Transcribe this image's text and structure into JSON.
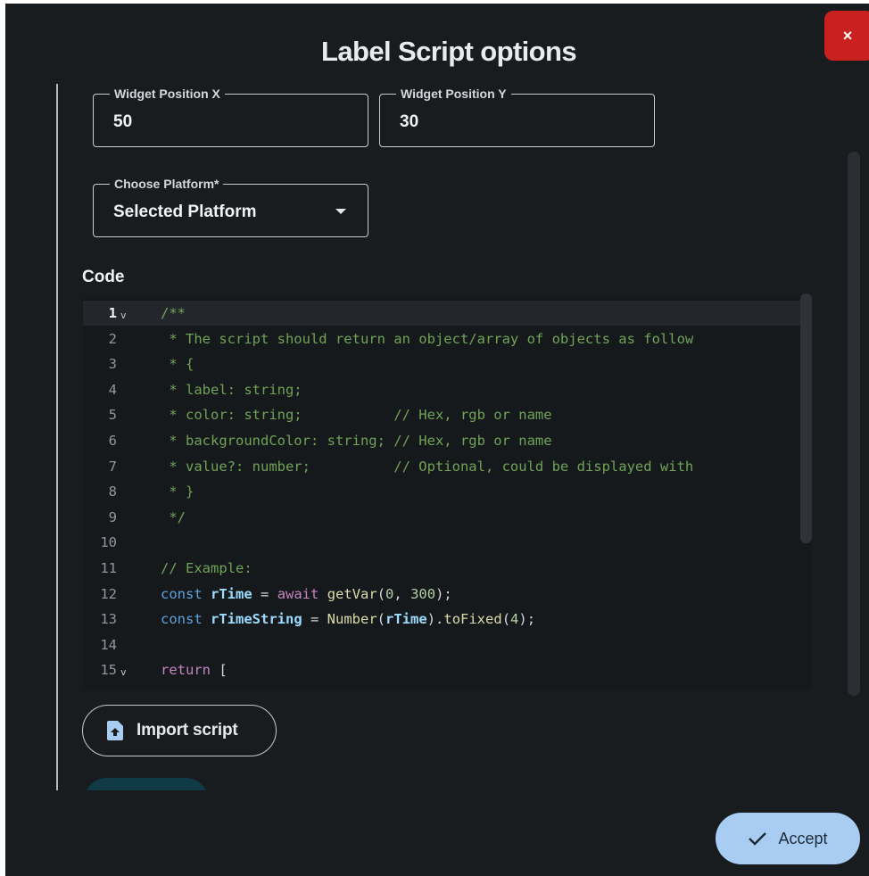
{
  "dialog": {
    "title": "Label Script options",
    "close_label": "×"
  },
  "fields": {
    "position_x": {
      "legend": "Widget Position X",
      "value": "50"
    },
    "position_y": {
      "legend": "Widget Position Y",
      "value": "30"
    },
    "platform": {
      "legend": "Choose Platform*",
      "value": "Selected Platform"
    }
  },
  "code": {
    "label": "Code",
    "lines": [
      {
        "n": "1",
        "fold": true,
        "active": true,
        "text": "/**"
      },
      {
        "n": "2",
        "text": " * The script should return an object/array of objects as follow"
      },
      {
        "n": "3",
        "text": " * {"
      },
      {
        "n": "4",
        "text": " * label: string;"
      },
      {
        "n": "5",
        "text": " * color: string;           // Hex, rgb or name"
      },
      {
        "n": "6",
        "text": " * backgroundColor: string; // Hex, rgb or name"
      },
      {
        "n": "7",
        "text": " * value?: number;          // Optional, could be displayed with"
      },
      {
        "n": "8",
        "text": " * }"
      },
      {
        "n": "9",
        "text": " */"
      },
      {
        "n": "10",
        "text": ""
      },
      {
        "n": "11",
        "text": "// Example:"
      },
      {
        "n": "12",
        "text": "const rTime = await getVar(0, 300);"
      },
      {
        "n": "13",
        "text": "const rTimeString = Number(rTime).toFixed(4);"
      },
      {
        "n": "14",
        "text": ""
      },
      {
        "n": "15",
        "fold": true,
        "text": "return ["
      }
    ]
  },
  "buttons": {
    "import_label": "Import script",
    "accept_label": "Accept"
  },
  "icons": {
    "import": "file-upload-icon",
    "accept": "check-icon",
    "close": "close-icon",
    "fold": "chevron-down-icon"
  },
  "colors": {
    "background": "#191c1f",
    "close_button": "#c9211e",
    "accept_button": "#a9cdf2",
    "comment": "#6fa356",
    "keyword": "#5ea2dd"
  }
}
